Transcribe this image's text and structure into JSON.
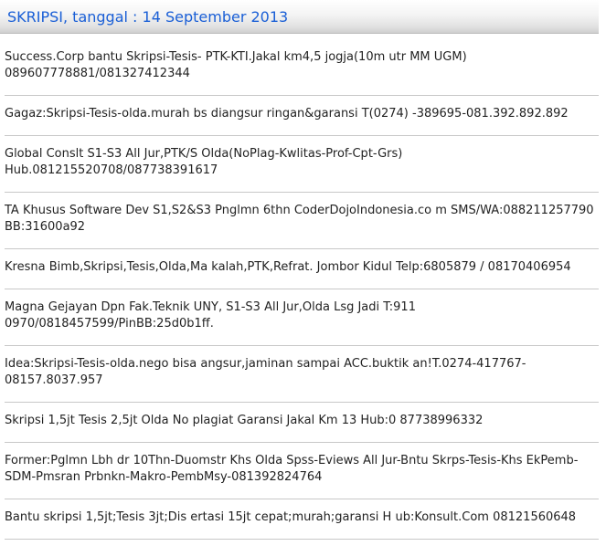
{
  "header": {
    "title": "SKRIPSI, tanggal : 14 September 2013"
  },
  "listings": [
    {
      "line1": "Success.Corp bantu Skripsi-Tesis- PTK-KTI.Jakal km4,5 jogja(10m utr MM UGM)",
      "line2": "089607778881/081327412344"
    },
    {
      "line1": "Gagaz:Skripsi-Tesis-olda.murah bs diangsur ringan&garansi T(0274) -389695-081.392.892.892",
      "line2": ""
    },
    {
      "line1": "Global Conslt S1-S3 All Jur,PTK/S Olda(NoPlag-Kwlitas-Prof-Cpt-Grs)",
      "line2": "Hub.081215520708/087738391617"
    },
    {
      "line1": "TA Khusus Software Dev S1,S2&S3 Pnglmn 6thn CoderDojoIndonesia.co m SMS/WA:088211257790",
      "line2": "BB:31600a92"
    },
    {
      "line1": "Kresna Bimb,Skripsi,Tesis,Olda,Ma kalah,PTK,Refrat. Jombor Kidul Telp:6805879 / 08170406954",
      "line2": ""
    },
    {
      "line1": "Magna Gejayan Dpn Fak.Teknik UNY, S1-S3 All Jur,Olda Lsg Jadi T:911",
      "line2": "0970/0818457599/PinBB:25d0b1ff."
    },
    {
      "line1": "Idea:Skripsi-Tesis-olda.nego bisa angsur,jaminan sampai ACC.buktik an!T.0274-417767-",
      "line2": "08157.8037.957"
    },
    {
      "line1": "Skripsi 1,5jt Tesis 2,5jt Olda No plagiat Garansi Jakal Km 13 Hub:0 87738996332",
      "line2": ""
    },
    {
      "line1": "Former:Pglmn Lbh dr 10Thn-Duomstr Khs Olda Spss-Eviews All Jur-Bntu Skrps-Tesis-Khs EkPemb-",
      "line2": "SDM-Pmsran Prbnkn-Makro-PembMsy-081392824764"
    },
    {
      "line1": "Bantu skripsi 1,5jt;Tesis 3jt;Dis ertasi 15jt cepat;murah;garansi H ub:Konsult.Com 08121560648",
      "line2": ""
    }
  ]
}
